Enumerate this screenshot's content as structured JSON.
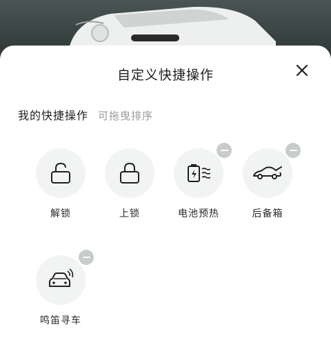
{
  "sheet": {
    "title": "自定义快捷操作",
    "section_title": "我的快捷操作",
    "section_hint": "可拖曳排序"
  },
  "actions": [
    {
      "label": "解锁",
      "icon": "unlock-icon",
      "removable": false
    },
    {
      "label": "上锁",
      "icon": "lock-icon",
      "removable": false
    },
    {
      "label": "电池预热",
      "icon": "battery-preheat-icon",
      "removable": true
    },
    {
      "label": "后备箱",
      "icon": "trunk-icon",
      "removable": true
    },
    {
      "label": "鸣笛寻车",
      "icon": "horn-find-car-icon",
      "removable": true
    }
  ],
  "colors": {
    "sheet_bg": "#ffffff",
    "icon_circle": "#f2f3f3",
    "badge": "#c9cccc",
    "text_primary": "#1f1f1f",
    "text_hint": "#9a9a9a"
  }
}
